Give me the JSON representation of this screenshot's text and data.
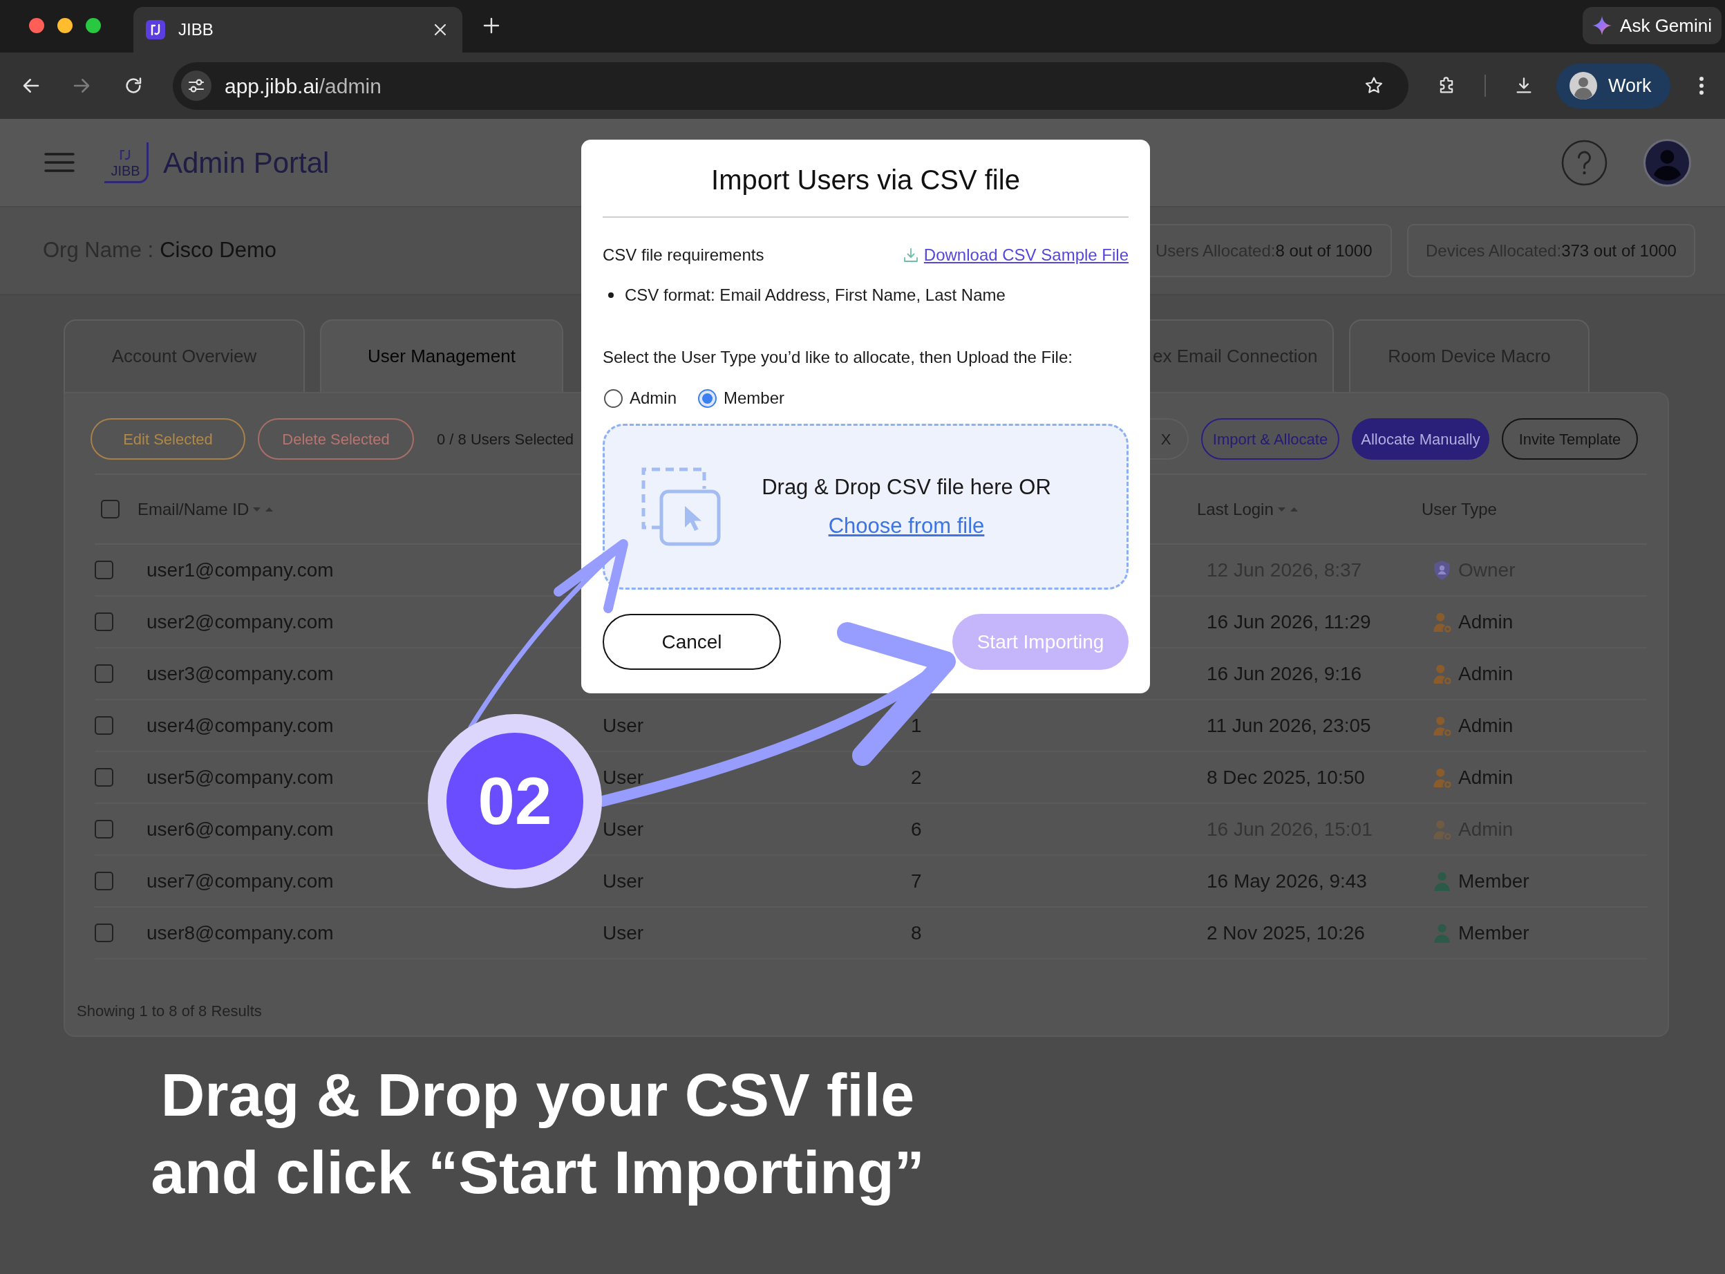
{
  "browser": {
    "tabs": [
      {
        "title": "JIBB",
        "selected": true
      }
    ],
    "url_host": "app.jibb.ai",
    "url_path": "/admin",
    "gemini": "Ask Gemini",
    "profile": "Work"
  },
  "header": {
    "logo": "JIBB",
    "title": "Admin Portal"
  },
  "org": {
    "label": "Org Name :",
    "value": "Cisco Demo"
  },
  "stats": [
    {
      "label": "Users Allocated:",
      "value": "8 out of 1000"
    },
    {
      "label": "Devices Allocated:",
      "value": "373 out of 1000"
    }
  ],
  "tabs": [
    {
      "label": "Account Overview",
      "selected": false
    },
    {
      "label": "User Management",
      "selected": true
    },
    {
      "label": "ex Email Connection",
      "selected": false
    },
    {
      "label": "Room Device Macro",
      "selected": false
    }
  ],
  "toolbar": {
    "bulk_actions": [
      {
        "label": "Edit Selected",
        "kind": "edit"
      },
      {
        "label": "Delete Selected",
        "kind": "delete"
      }
    ],
    "selection": "0 / 8 Users Selected",
    "search": {
      "clear": "X"
    },
    "actions": [
      {
        "label": "Import & Allocate",
        "kind": "outline"
      },
      {
        "label": "Allocate Manually",
        "kind": "filled"
      },
      {
        "label": "Invite Template",
        "kind": "plain"
      }
    ]
  },
  "table": {
    "select_all_checked": false,
    "columns": [
      {
        "label": "Email/Name ID",
        "sortable": true
      },
      {
        "label": "Last Login",
        "sortable": true
      },
      {
        "label": "User Type",
        "sortable": false
      }
    ],
    "rows": [
      {
        "checked": false,
        "email": "user1@company.com",
        "last_login": "12 Jun 2026, 8:37",
        "user_type": "Owner",
        "kind": "owner",
        "dimmed": true
      },
      {
        "checked": false,
        "email": "user2@company.com",
        "last_login": "16 Jun 2026, 11:29",
        "user_type": "Admin",
        "kind": "admin",
        "dimmed": false
      },
      {
        "checked": false,
        "email": "user3@company.com",
        "last_login": "16 Jun 2026, 9:16",
        "user_type": "Admin",
        "kind": "admin",
        "dimmed": false
      },
      {
        "checked": false,
        "email": "user4@company.com",
        "column_2": "User",
        "column_3": "1",
        "last_login": "11 Jun 2026, 23:05",
        "user_type": "Admin",
        "kind": "admin",
        "dimmed": false
      },
      {
        "checked": false,
        "email": "user5@company.com",
        "column_2": "User",
        "column_3": "2",
        "last_login": "8 Dec 2025, 10:50",
        "user_type": "Admin",
        "kind": "admin",
        "dimmed": false
      },
      {
        "checked": false,
        "email": "user6@company.com",
        "column_2": "User",
        "column_3": "6",
        "last_login": "16 Jun 2026, 15:01",
        "user_type": "Admin",
        "kind": "admin",
        "dimmed": true
      },
      {
        "checked": false,
        "email": "user7@company.com",
        "column_2": "User",
        "column_3": "7",
        "last_login": "16 May 2026, 9:43",
        "user_type": "Member",
        "kind": "member",
        "dimmed": false
      },
      {
        "checked": false,
        "email": "user8@company.com",
        "column_2": "User",
        "column_3": "8",
        "last_login": "2 Nov 2025, 10:26",
        "user_type": "Member",
        "kind": "member",
        "dimmed": false
      }
    ],
    "footer": "Showing 1 to 8 of 8 Results"
  },
  "modal": {
    "title": "Import Users via CSV file",
    "requirements_label": "CSV file requirements",
    "download_link": "Download CSV Sample File",
    "requirements": [
      "CSV format: Email Address, First Name, Last Name"
    ],
    "prompt": "Select the User Type you’d like to allocate, then Upload the File:",
    "user_types": [
      {
        "label": "Admin",
        "selected": false
      },
      {
        "label": "Member",
        "selected": true
      }
    ],
    "dropzone": {
      "text": "Drag & Drop CSV file here OR",
      "link": "Choose from file"
    },
    "buttons": [
      {
        "label": "Cancel",
        "kind": "secondary",
        "disabled": false
      },
      {
        "label": "Start Importing",
        "kind": "primary",
        "disabled": true
      }
    ]
  },
  "overlay": {
    "step": "02",
    "caption": [
      "Drag & Drop your CSV file",
      "and click “Start Importing”"
    ]
  }
}
